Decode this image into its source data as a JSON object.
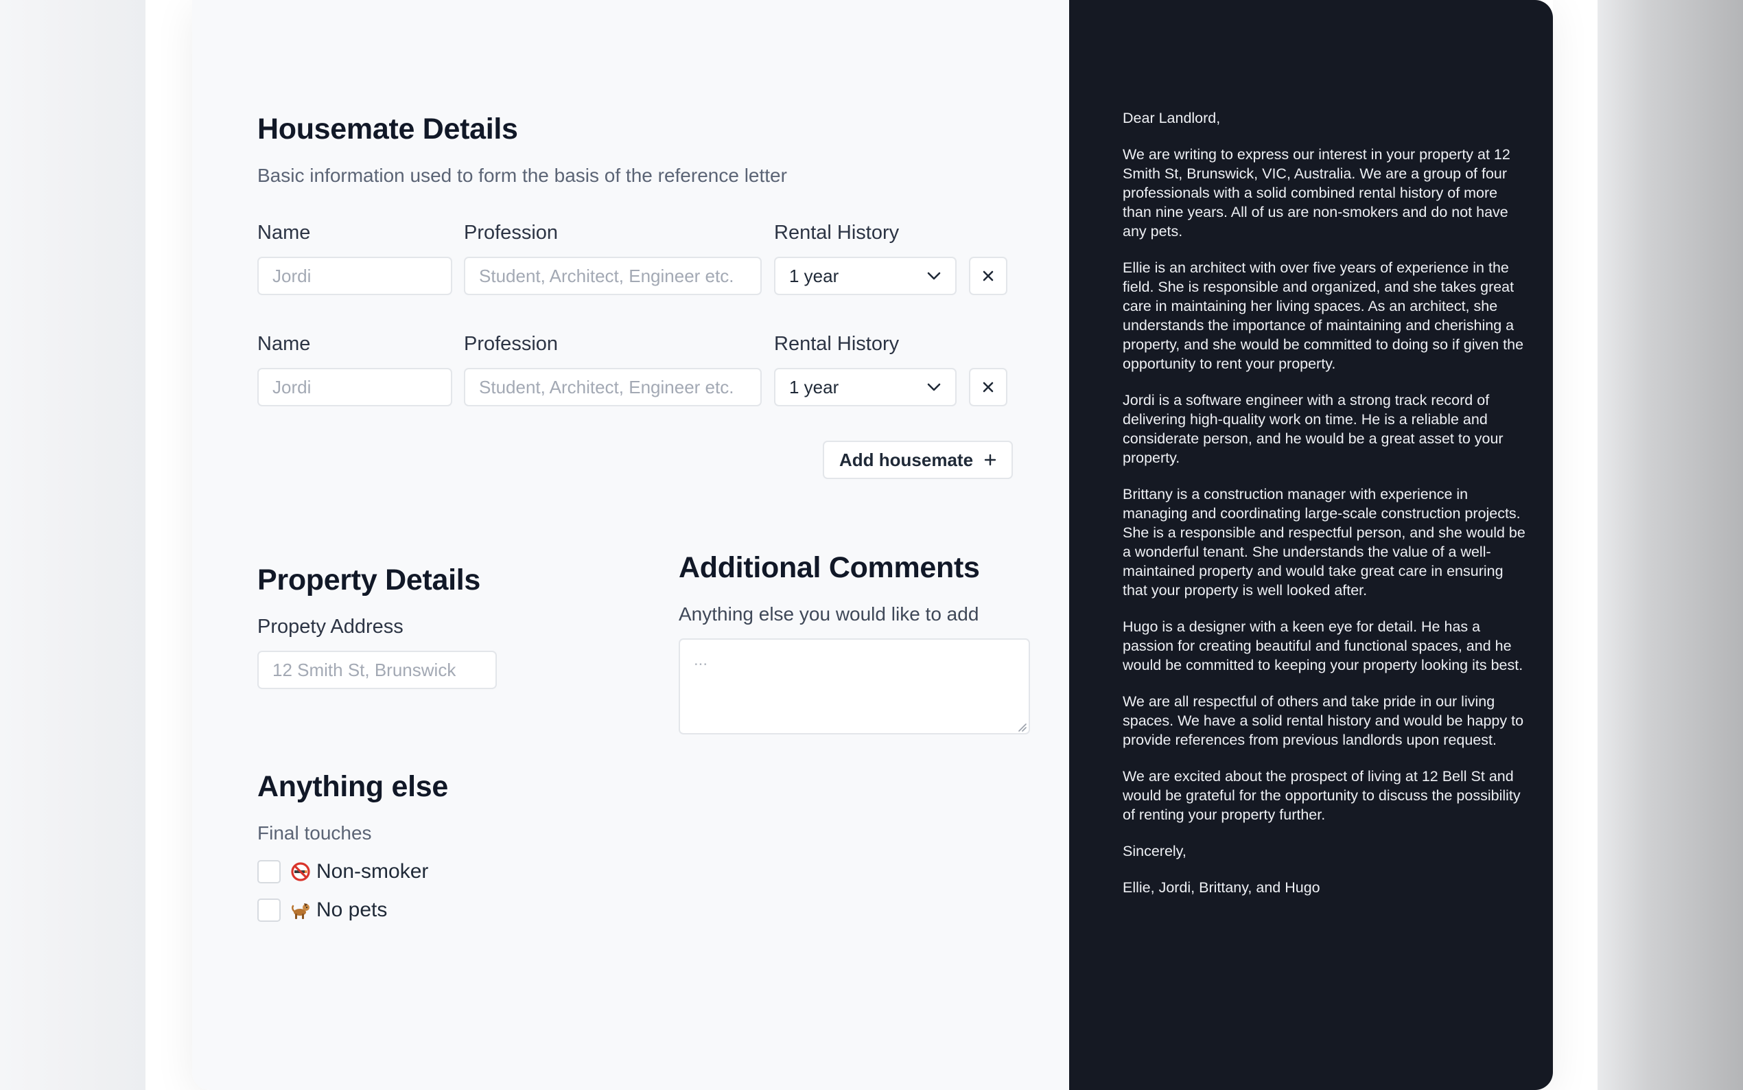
{
  "housemate_section": {
    "title": "Housemate Details",
    "subtitle": "Basic information used to form the basis of the reference letter",
    "rows": [
      {
        "name_label": "Name",
        "name_placeholder": "Jordi",
        "profession_label": "Profession",
        "profession_placeholder": "Student, Architect, Engineer etc.",
        "rental_label": "Rental History",
        "rental_value": "1 year"
      },
      {
        "name_label": "Name",
        "name_placeholder": "Jordi",
        "profession_label": "Profession",
        "profession_placeholder": "Student, Architect, Engineer etc.",
        "rental_label": "Rental History",
        "rental_value": "1 year"
      }
    ],
    "add_button_label": "Add housemate"
  },
  "property_section": {
    "title": "Property Details",
    "address_label": "Propety Address",
    "address_placeholder": "12 Smith St, Brunswick"
  },
  "comments_section": {
    "title": "Additional Comments",
    "subtitle": "Anything else you would like to add",
    "placeholder": "..."
  },
  "else_section": {
    "title": "Anything else",
    "subtitle": "Final touches",
    "options": [
      {
        "label": "Non-smoker",
        "icon": "no-smoking-icon",
        "checked": false
      },
      {
        "label": "No pets",
        "icon": "dog-icon",
        "checked": false
      }
    ]
  },
  "letter": {
    "paragraphs": [
      "Dear Landlord,",
      "We are writing to express our interest in your property at 12 Smith St, Brunswick, VIC, Australia. We are a group of four professionals with a solid combined rental history of more than nine years. All of us are non-smokers and do not have any pets.",
      "Ellie is an architect with over five years of experience in the field. She is responsible and organized, and she takes great care in maintaining her living spaces. As an architect, she understands the importance of maintaining and cherishing a property, and she would be committed to doing so if given the opportunity to rent your property.",
      "Jordi is a software engineer with a strong track record of delivering high-quality work on time. He is a reliable and considerate person, and he would be a great asset to your property.",
      "Brittany is a construction manager with experience in managing and coordinating large-scale construction projects. She is a responsible and respectful person, and she would be a wonderful tenant. She understands the value of a well-maintained property and would take great care in ensuring that your property is well looked after.",
      "Hugo is a designer with a keen eye for detail. He has a passion for creating beautiful and functional spaces, and he would be committed to keeping your property looking its best.",
      "We are all respectful of others and take pride in our living spaces. We have a solid rental history and would be happy to provide references from previous landlords upon request.",
      "We are excited about the prospect of living at 12 Bell St and would be grateful for the opportunity to discuss the possibility of renting your property further.",
      "Sincerely,",
      "Ellie, Jordi, Brittany, and Hugo"
    ]
  },
  "colors": {
    "form_background": "#f8f9fb",
    "letter_background": "#151923",
    "letter_text": "#eef0f4",
    "heading_text": "#111827",
    "input_border": "#e3e6ea"
  }
}
